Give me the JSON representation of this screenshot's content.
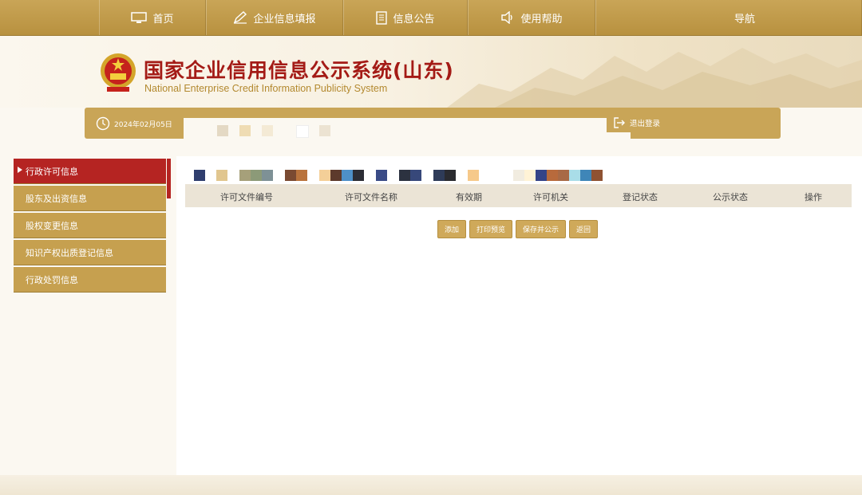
{
  "nav": {
    "home": "首页",
    "fill": "企业信息填报",
    "notice": "信息公告",
    "help": "使用帮助",
    "guide": "导航"
  },
  "header": {
    "title": "国家企业信用信息公示系统(山东)",
    "subtitle": "National Enterprise Credit Information Publicity System"
  },
  "infobar": {
    "date": "2024年02月05日",
    "logout": "退出登录"
  },
  "sidebar": {
    "items": [
      {
        "label": "行政许可信息",
        "active": true
      },
      {
        "label": "股东及出资信息",
        "active": false
      },
      {
        "label": "股权变更信息",
        "active": false
      },
      {
        "label": "知识产权出质登记信息",
        "active": false
      },
      {
        "label": "行政处罚信息",
        "active": false
      }
    ]
  },
  "table": {
    "columns": [
      "许可文件编号",
      "许可文件名称",
      "有效期",
      "许可机关",
      "登记状态",
      "公示状态",
      "操作"
    ]
  },
  "actions": {
    "add": "添加",
    "print": "打印预览",
    "save_publish": "保存并公示",
    "back": "返回"
  },
  "colors": {
    "gold": "#c9a557",
    "active_red": "#b52422",
    "title_red": "#a41b16"
  }
}
